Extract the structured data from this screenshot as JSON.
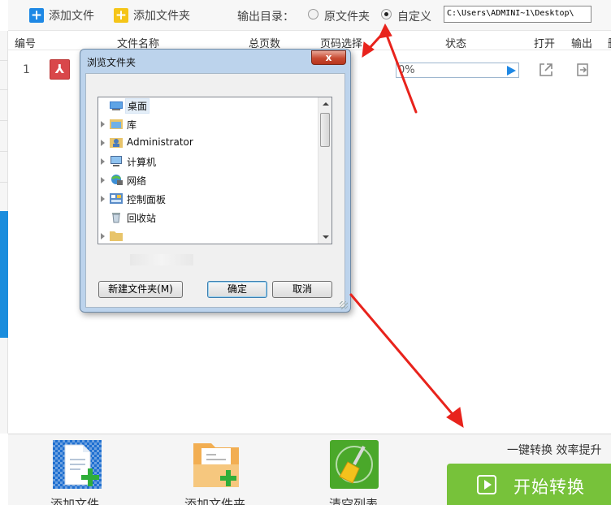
{
  "toolbar": {
    "add_file": "添加文件",
    "add_folder": "添加文件夹",
    "output_label": "输出目录：",
    "radio_original": "原文件夹",
    "radio_custom": "自定义",
    "output_path": "C:\\Users\\ADMINI~1\\Desktop\\"
  },
  "table": {
    "headers": [
      "编号",
      "文件名称",
      "总页数",
      "页码选择",
      "状态",
      "打开",
      "输出",
      "删"
    ],
    "rows": [
      {
        "num": "1",
        "file_icon": "pdf-icon",
        "progress_text": "0%",
        "progress_value": 0
      }
    ]
  },
  "dialog": {
    "title": "浏览文件夹",
    "close": "x",
    "tree": [
      {
        "label": "桌面",
        "icon": "desktop-icon"
      },
      {
        "label": "库",
        "icon": "library-icon"
      },
      {
        "label": "Administrator",
        "icon": "user-folder-icon"
      },
      {
        "label": "计算机",
        "icon": "computer-icon"
      },
      {
        "label": "网络",
        "icon": "network-icon"
      },
      {
        "label": "控制面板",
        "icon": "control-panel-icon"
      },
      {
        "label": "回收站",
        "icon": "recycle-bin-icon"
      },
      {
        "label": "",
        "icon": "folder-icon"
      }
    ],
    "new_folder": "新建文件夹(M)",
    "ok": "确定",
    "cancel": "取消"
  },
  "bottom": {
    "add_file": "添加文件",
    "add_folder": "添加文件夹",
    "clear_list": "清空列表",
    "slogan": "一键转换  效率提升",
    "start": "开始转换"
  },
  "colors": {
    "accent_blue": "#1e88e5",
    "start_green": "#77c23a",
    "arrow_red": "#e8231c",
    "pdf_red": "#d9474a"
  }
}
